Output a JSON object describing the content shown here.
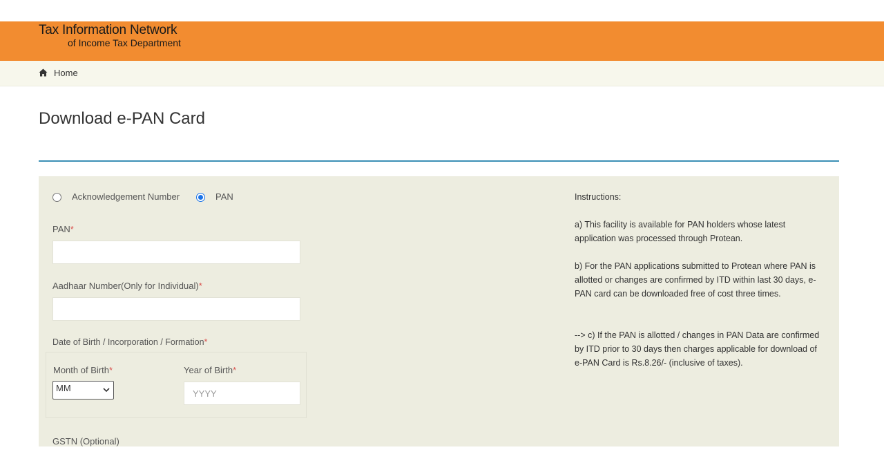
{
  "header": {
    "title_line1": "Tax Information Network",
    "title_line2": "of Income Tax Department",
    "bg_color": "#f28c30"
  },
  "breadcrumb": {
    "icon": "home-icon",
    "home_label": "Home"
  },
  "page": {
    "title": "Download e-PAN Card"
  },
  "form": {
    "mode_options": [
      {
        "label": "Acknowledgement Number",
        "selected": false
      },
      {
        "label": "PAN",
        "selected": true
      }
    ],
    "pan_label": "PAN",
    "pan_value": "",
    "aadhaar_label": "Aadhaar Number(Only for Individual)",
    "aadhaar_value": "",
    "dob_label": "Date of Birth / Incorporation / Formation",
    "month_label": "Month of Birth",
    "month_selected": "MM",
    "year_label": "Year of Birth",
    "year_placeholder": "YYYY",
    "gstn_label": "GSTN (Optional)",
    "required_marker": "*"
  },
  "instructions": {
    "heading": "Instructions:",
    "items": [
      "a) This facility is available for PAN holders whose latest application was processed through Protean.",
      "b) For the PAN applications submitted to Protean where PAN is allotted or changes are confirmed by ITD within last 30 days, e-PAN card can be downloaded free of cost three times.",
      "--> c) If the PAN is allotted / changes in PAN Data are confirmed by ITD prior to 30 days then charges applicable for download of e-PAN Card is Rs.8.26/- (inclusive of taxes)."
    ]
  }
}
